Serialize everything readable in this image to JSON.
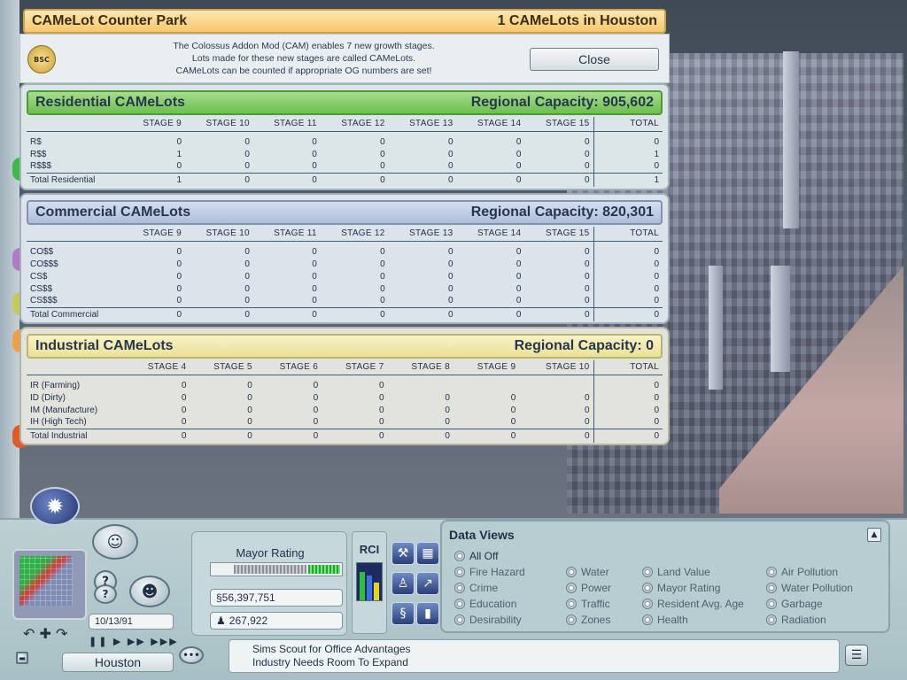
{
  "panel": {
    "title": "CAMeLot Counter Park",
    "count_text": "1 CAMeLots in Houston",
    "logo_text": "BSC",
    "info_lines": [
      "The Colossus Addon Mod (CAM) enables 7 new growth stages.",
      "Lots made for these new stages are called CAMeLots.",
      "CAMeLots can be counted if appropriate OG numbers are set!"
    ],
    "close_label": "Close"
  },
  "residential": {
    "title": "Residential CAMeLots",
    "capacity": "Regional Capacity: 905,602",
    "headers": [
      "",
      "STAGE 9",
      "STAGE 10",
      "STAGE 11",
      "STAGE 12",
      "STAGE 13",
      "STAGE 14",
      "STAGE 15",
      "TOTAL"
    ],
    "rows": [
      [
        "R$",
        "0",
        "0",
        "0",
        "0",
        "0",
        "0",
        "0",
        "0"
      ],
      [
        "R$$",
        "1",
        "0",
        "0",
        "0",
        "0",
        "0",
        "0",
        "1"
      ],
      [
        "R$$$",
        "0",
        "0",
        "0",
        "0",
        "0",
        "0",
        "0",
        "0"
      ]
    ],
    "total": [
      "Total Residential",
      "1",
      "0",
      "0",
      "0",
      "0",
      "0",
      "0",
      "1"
    ]
  },
  "commercial": {
    "title": "Commercial CAMeLots",
    "capacity": "Regional Capacity: 820,301",
    "headers": [
      "",
      "STAGE 9",
      "STAGE 10",
      "STAGE 11",
      "STAGE 12",
      "STAGE 13",
      "STAGE 14",
      "STAGE 15",
      "TOTAL"
    ],
    "rows": [
      [
        "CO$$",
        "0",
        "0",
        "0",
        "0",
        "0",
        "0",
        "0",
        "0"
      ],
      [
        "CO$$$",
        "0",
        "0",
        "0",
        "0",
        "0",
        "0",
        "0",
        "0"
      ],
      [
        "CS$",
        "0",
        "0",
        "0",
        "0",
        "0",
        "0",
        "0",
        "0"
      ],
      [
        "CS$$",
        "0",
        "0",
        "0",
        "0",
        "0",
        "0",
        "0",
        "0"
      ],
      [
        "CS$$$",
        "0",
        "0",
        "0",
        "0",
        "0",
        "0",
        "0",
        "0"
      ]
    ],
    "total": [
      "Total Commercial",
      "0",
      "0",
      "0",
      "0",
      "0",
      "0",
      "0",
      "0"
    ]
  },
  "industrial": {
    "title": "Industrial CAMeLots",
    "capacity": "Regional Capacity: 0",
    "headers": [
      "",
      "STAGE 4",
      "STAGE 5",
      "STAGE 6",
      "STAGE 7",
      "STAGE 8",
      "STAGE 9",
      "STAGE 10",
      "TOTAL"
    ],
    "rows": [
      [
        "IR (Farming)",
        "0",
        "0",
        "0",
        "0",
        "",
        "",
        "",
        "0"
      ],
      [
        "ID (Dirty)",
        "0",
        "0",
        "0",
        "0",
        "0",
        "0",
        "0",
        "0"
      ],
      [
        "IM (Manufacture)",
        "0",
        "0",
        "0",
        "0",
        "0",
        "0",
        "0",
        "0"
      ],
      [
        "IH (High Tech)",
        "0",
        "0",
        "0",
        "0",
        "0",
        "0",
        "0",
        "0"
      ]
    ],
    "total": [
      "Total Industrial",
      "0",
      "0",
      "0",
      "0",
      "0",
      "0",
      "0",
      "0"
    ]
  },
  "hud": {
    "date": "10/13/91",
    "city_name": "Houston",
    "mayor_rating_label": "Mayor Rating",
    "mayor_rating_level": 0.3,
    "funds": "§56,397,751",
    "population": "267,922",
    "rci_label": "RCI",
    "rci_levels": {
      "R": 0.8,
      "C": 0.7,
      "I": 0.5
    },
    "rci_colors": {
      "R": "#2fbf3a",
      "C": "#3a6fe0",
      "I": "#e8d21d"
    },
    "news_lines": [
      "Sims Scout for Office Advantages",
      "Industry Needs Room To Expand"
    ],
    "help_label": "?",
    "speed_glyphs": "❚❚ ▶ ▶▶ ▶▶▶",
    "nav_glyphs": "↶ ✚ ↷"
  },
  "dataviews": {
    "title": "Data Views",
    "items": [
      [
        "All Off"
      ],
      [
        "Fire Hazard",
        "Water",
        "Land Value",
        "Air Pollution"
      ],
      [
        "Crime",
        "Power",
        "Mayor Rating",
        "Water Pollution"
      ],
      [
        "Education",
        "Traffic",
        "Resident Avg. Age",
        "Garbage"
      ],
      [
        "Desirability",
        "Zones",
        "Health",
        "Radiation"
      ]
    ]
  },
  "colors": {
    "res_header": "#6dbf4e",
    "com_header": "#aebed8",
    "ind_header": "#ebe197",
    "title_bar": "#f6c86c"
  },
  "icons": [
    "sun-icon",
    "help-icon",
    "sims-icon",
    "advisor-icon",
    "news-icon",
    "minimize-icon",
    "dollar-icon",
    "person-icon"
  ]
}
